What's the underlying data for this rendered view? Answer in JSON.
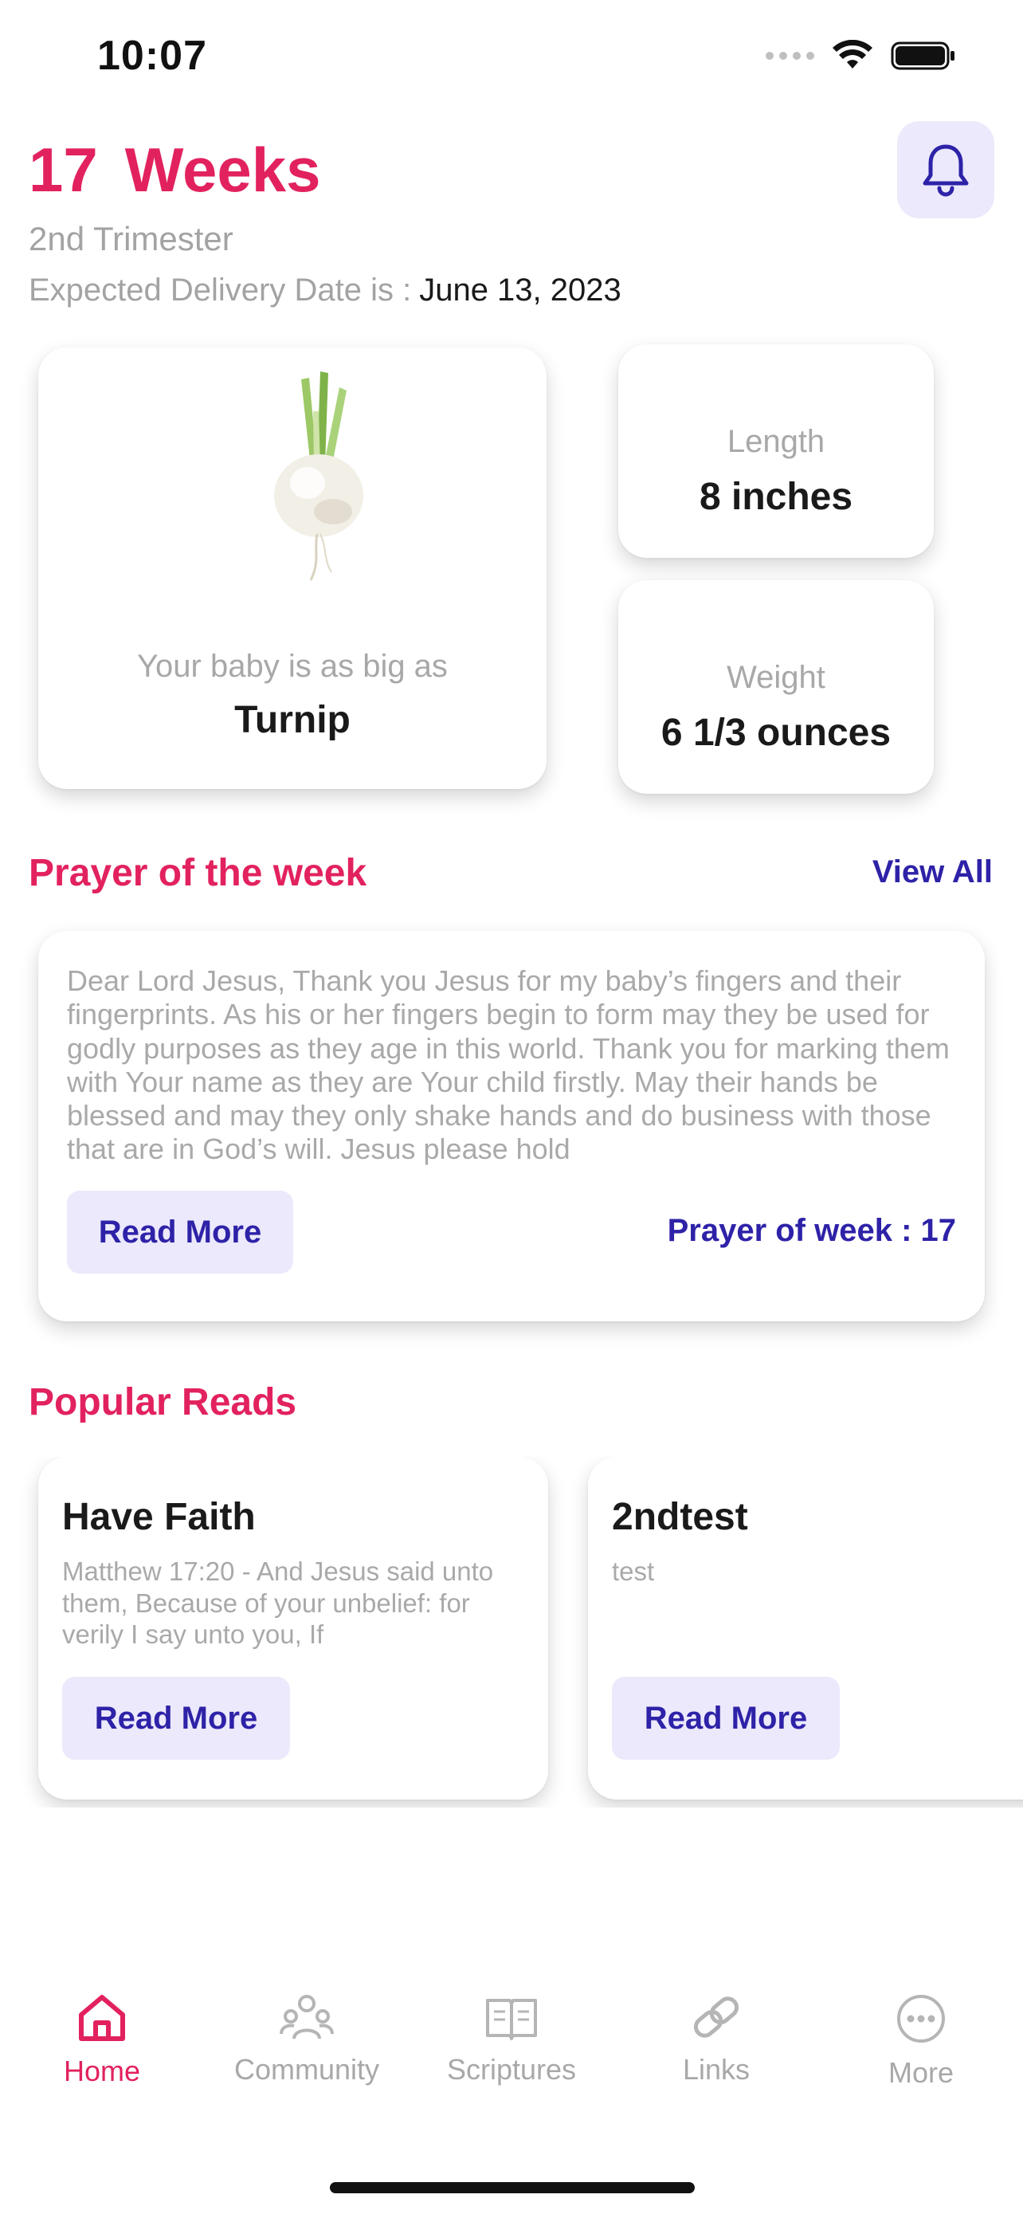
{
  "status_bar": {
    "time": "10:07"
  },
  "header": {
    "weeks_number": "17",
    "weeks_label": "Weeks",
    "trimester": "2nd Trimester",
    "delivery_label": "Expected Delivery Date is :",
    "delivery_date": "June 13, 2023"
  },
  "baby_size": {
    "image_icon": "turnip-image",
    "label": "Your baby is as big as",
    "value": "Turnip"
  },
  "length": {
    "label": "Length",
    "value": "8 inches"
  },
  "weight": {
    "label": "Weight",
    "value": "6 1/3 ounces"
  },
  "prayer": {
    "section_title": "Prayer of the week",
    "view_all": "View All",
    "text": "Dear Lord Jesus, Thank you Jesus for my baby’s fingers and their fingerprints. As his or her fingers begin to form may they be used for godly purposes as they age in this world. Thank you for marking them with Your name as they are Your child firstly. May their hands be blessed and may they only shake hands and do business with those that are in God’s will. Jesus please hold",
    "read_more": "Read More",
    "week_label": "Prayer of week : 17"
  },
  "popular_reads": {
    "section_title": "Popular Reads",
    "items": [
      {
        "title": "Have Faith",
        "body": "Matthew 17:20 - And Jesus said unto them, Because of your unbelief: for verily I say unto you, If",
        "read_more": "Read More"
      },
      {
        "title": "2ndtest",
        "body": "test",
        "read_more": "Read More"
      }
    ]
  },
  "nav": {
    "items": [
      {
        "label": "Home",
        "icon": "home-icon",
        "active": true
      },
      {
        "label": "Community",
        "icon": "community-icon",
        "active": false
      },
      {
        "label": "Scriptures",
        "icon": "book-icon",
        "active": false
      },
      {
        "label": "Links",
        "icon": "link-icon",
        "active": false
      },
      {
        "label": "More",
        "icon": "more-icon",
        "active": false
      }
    ]
  },
  "colors": {
    "accent_pink": "#e2225e",
    "accent_indigo": "#2e22a8",
    "button_bg": "#ebe9fb",
    "muted_text": "#a8a8a8"
  }
}
